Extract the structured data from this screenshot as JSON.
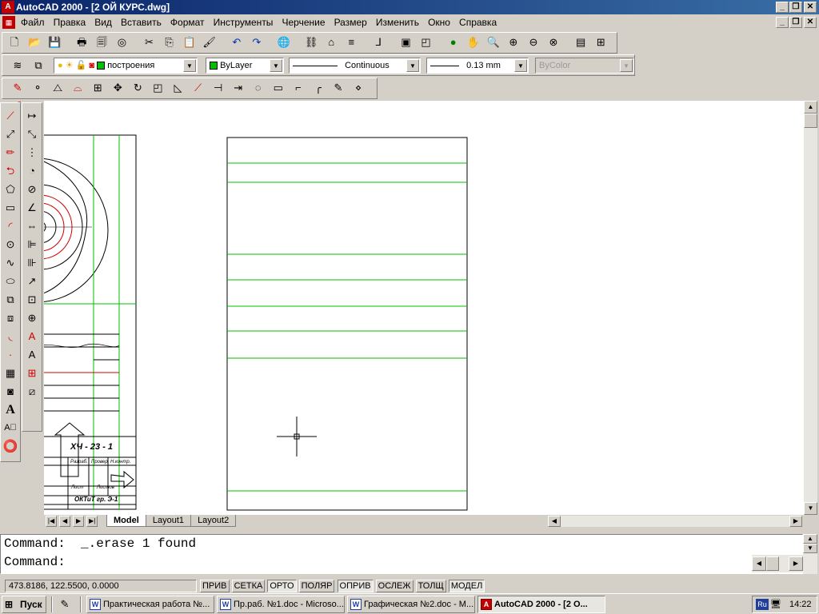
{
  "window": {
    "title": "AutoCAD 2000 - [2 ОЙ КУРС.dwg]",
    "icon": "autocad-app-icon",
    "controls": [
      "_",
      "❐",
      "✕"
    ]
  },
  "menu": {
    "items": [
      "Файл",
      "Правка",
      "Вид",
      "Вставить",
      "Формат",
      "Инструменты",
      "Черчение",
      "Размер",
      "Изменить",
      "Окно",
      "Справка"
    ]
  },
  "properties": {
    "layer": "построения",
    "color": "ByLayer",
    "linetype": "Continuous",
    "lineweight": "0.13 mm",
    "plotstyle": "ByColor",
    "layer_color_hex": "#00c000"
  },
  "drawing": {
    "title_block": {
      "code": "ХЧ - 23 - 1",
      "row1": [
        "Разраб.",
        "Провер.",
        "Н.контр."
      ],
      "row2": [
        "Лист",
        "Листов"
      ],
      "footer": "ОКТиТ гр. Э-1"
    },
    "colors": {
      "frame": "#000000",
      "guide_lines": "#00c000",
      "construction": "#ff0000"
    }
  },
  "layout_tabs": {
    "items": [
      "Model",
      "Layout1",
      "Layout2"
    ],
    "active": "Model"
  },
  "command_line": {
    "line1": "Command:  _.erase 1 found",
    "line2": "Command:"
  },
  "status": {
    "coords": "473.8186, 122.5500, 0.0000",
    "toggles": [
      "ПРИВ",
      "СЕТКА",
      "ОРТО",
      "ПОЛЯР",
      "ОПРИВ",
      "ОСЛЕЖ",
      "ТОЛЩ",
      "МОДЕЛ"
    ],
    "pressed": [
      "ОРТО",
      "ОПРИВ",
      "МОДЕЛ"
    ]
  },
  "taskbar": {
    "start": "Пуск",
    "tasks": [
      "Практическая работа №...",
      "Пр.раб. №1.doc - Microso...",
      "Графическая №2.doc - M...",
      "AutoCAD 2000 - [2 О..."
    ],
    "active_task": "AutoCAD 2000 - [2 О...",
    "lang": "Ru",
    "clock": "14:22"
  }
}
